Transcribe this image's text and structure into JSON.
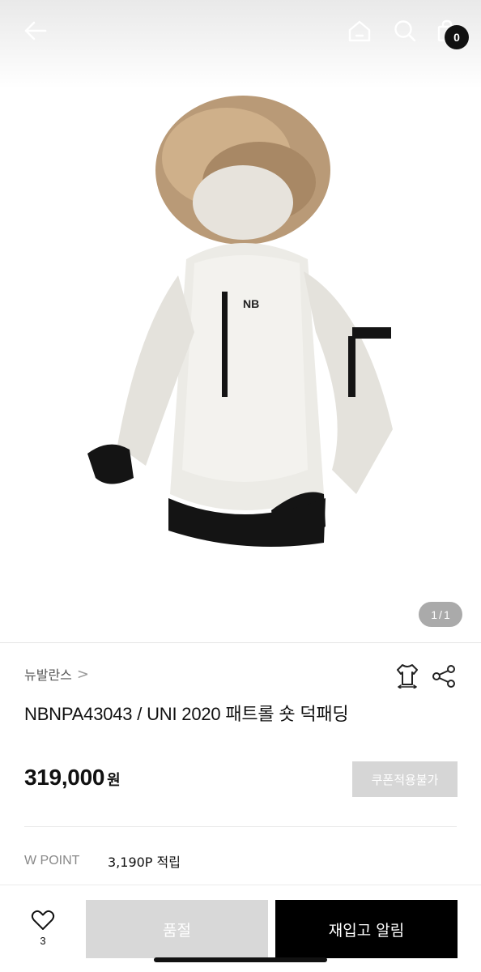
{
  "header": {
    "back_icon": "arrow-left-icon",
    "home_icon": "home-icon",
    "search_icon": "search-icon",
    "cart_icon": "shopping-bag-icon",
    "cart_count": "0"
  },
  "gallery": {
    "current": "1",
    "separator": "/",
    "total": "1"
  },
  "product": {
    "brand": "뉴발란스",
    "brand_chevron": ">",
    "name": "NBNPA43043 / UNI 2020 패트롤 숏 덕패딩",
    "price": "319,000",
    "currency": "원",
    "coupon_label": "쿠폰적용불가",
    "fit_icon": "shirt-size-icon",
    "share_icon": "share-icon"
  },
  "points": {
    "label": "W POINT",
    "value": "3,190P 적립"
  },
  "actions": {
    "like_icon": "heart-icon",
    "like_count": "3",
    "soldout_label": "품절",
    "restock_label": "재입고 알림"
  },
  "colors": {
    "accent": "#000000",
    "disabled": "#d8d8d8",
    "badge": "#111111"
  }
}
